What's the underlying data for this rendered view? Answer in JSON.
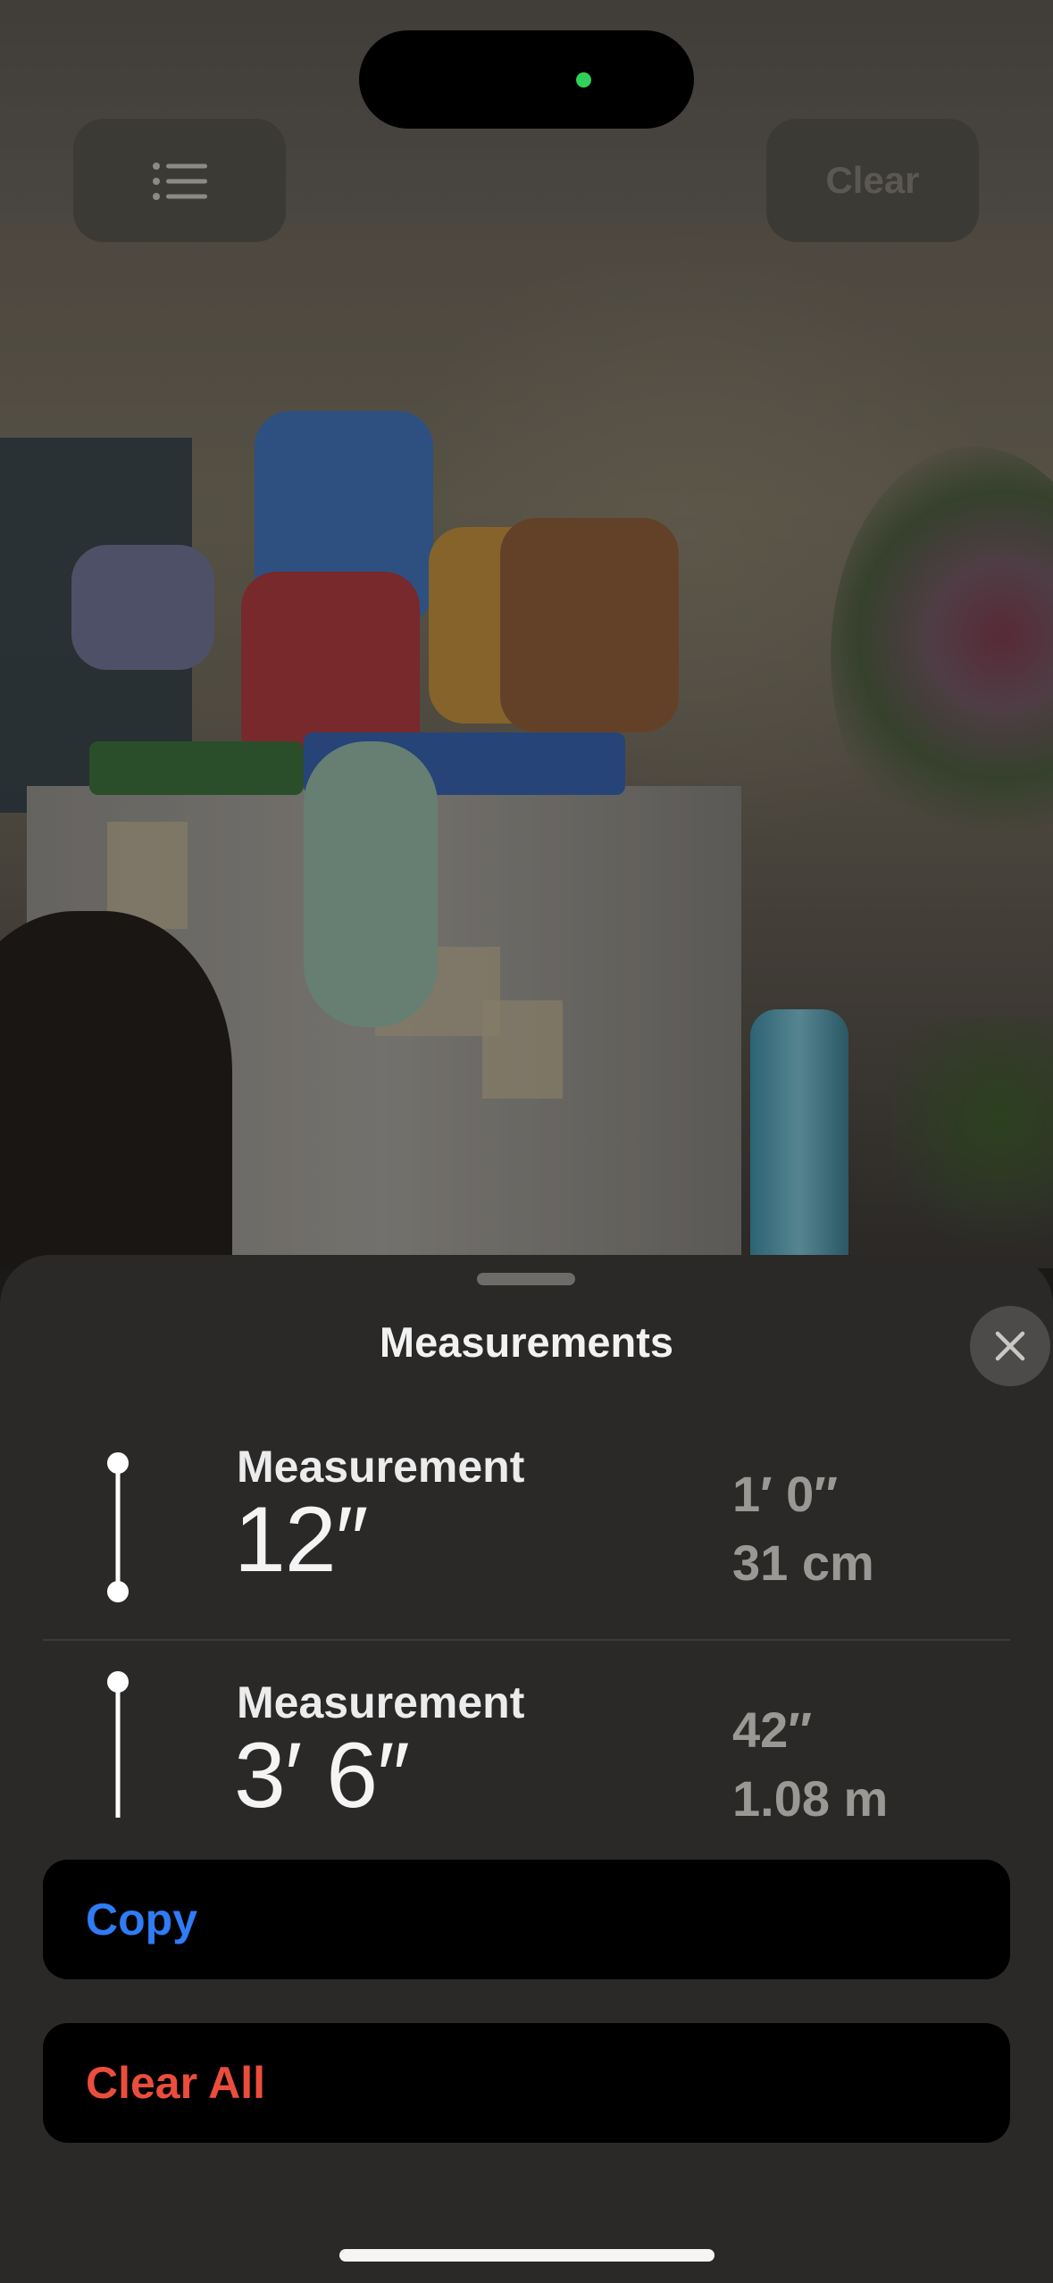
{
  "top_bar": {
    "clear_label": "Clear"
  },
  "sheet": {
    "title": "Measurements",
    "items": [
      {
        "name": "Measurement",
        "value": "12″",
        "alt_primary": "1′ 0″",
        "alt_secondary": "31 cm"
      },
      {
        "name": "Measurement",
        "value": "3′ 6″",
        "alt_primary": "42″",
        "alt_secondary": "1.08 m"
      }
    ]
  },
  "actions": {
    "copy_label": "Copy",
    "clear_all_label": "Clear All"
  },
  "colors": {
    "accent_blue": "#2f7cf6",
    "destructive_red": "#eb4d3d",
    "camera_indicator_green": "#30d158",
    "sheet_background": "#2a2928"
  },
  "icons": {
    "list": "list-icon",
    "close": "close-icon",
    "measurement": "measurement-line-icon"
  }
}
